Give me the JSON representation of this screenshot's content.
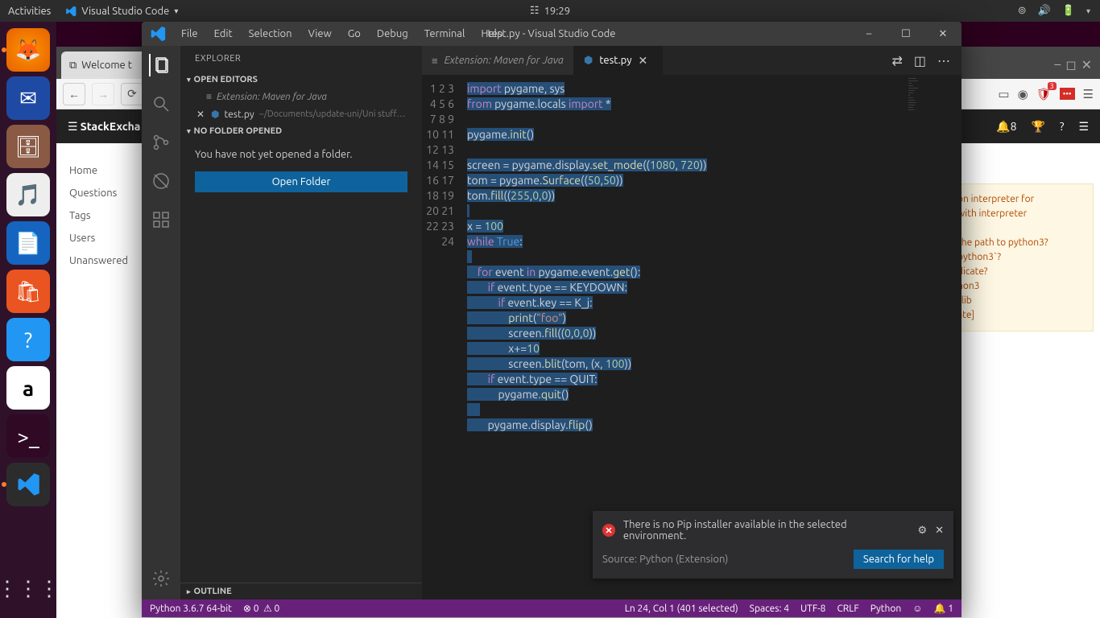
{
  "ubuntu": {
    "activities": "Activities",
    "app_name": "Visual Studio Code",
    "time": "19:29"
  },
  "browser": {
    "tab1": "Welcome t",
    "new_tab": "+",
    "se_brand": "StackExcha",
    "nav": [
      "Home",
      "Questions",
      "Tags",
      "Users",
      "Unanswered"
    ],
    "ans_lines": [
      "on interpreter for",
      "with interpreter",
      "the path to python3?",
      "python3`?",
      "dicate?",
      "hon3",
      "tlib",
      "ate]"
    ],
    "badge_3": "3",
    "badge_8": "8"
  },
  "vscode": {
    "menus": [
      "File",
      "Edit",
      "Selection",
      "View",
      "Go",
      "Debug",
      "Terminal",
      "Help"
    ],
    "title": "test.py - Visual Studio Code",
    "explorer": "EXPLORER",
    "open_editors": "OPEN EDITORS",
    "no_folder": "NO FOLDER OPENED",
    "outline": "OUTLINE",
    "editor_maven": "Extension: Maven for Java",
    "editor_test": "test.py",
    "editor_test_path": "~/Documents/update-uni/Uni stuff…",
    "no_folder_msg": "You have not yet opened a folder.",
    "open_folder_btn": "Open Folder",
    "tab_maven": "Extension: Maven for Java",
    "tab_test": "test.py"
  },
  "notification": {
    "msg": "There is no Pip installer available in the selected environment.",
    "source": "Source: Python (Extension)",
    "button": "Search for help"
  },
  "status": {
    "python": "Python 3.6.7 64-bit",
    "errs": "0",
    "warns": "0",
    "pos": "Ln 24, Col 1 (401 selected)",
    "spaces": "Spaces: 4",
    "enc": "UTF-8",
    "eol": "CRLF",
    "lang": "Python",
    "bell": "1"
  },
  "code": {
    "line_count": 24
  }
}
